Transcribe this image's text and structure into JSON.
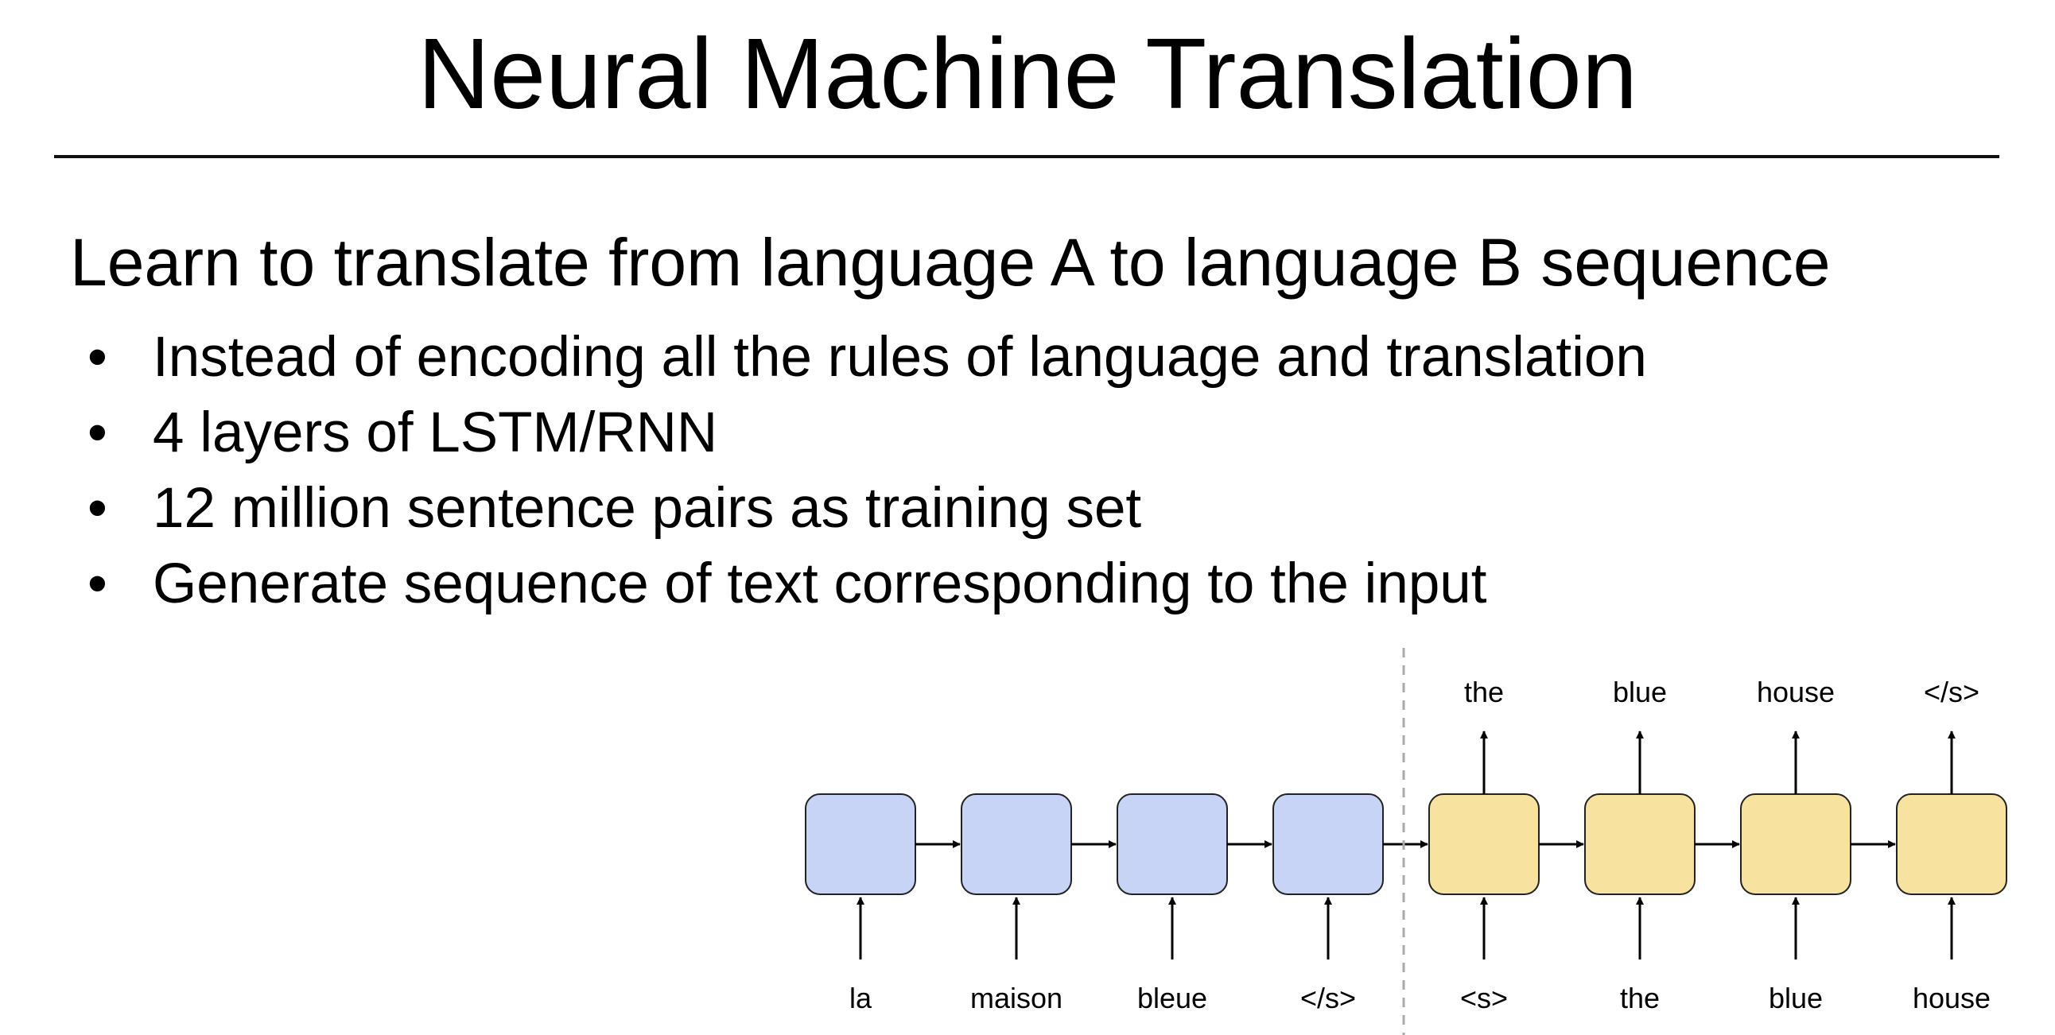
{
  "title": "Neural Machine Translation",
  "subtitle": "Learn to translate from language A to language B sequence",
  "bullets": [
    "Instead of encoding all the rules of language and translation",
    "4 layers of LSTM/RNN",
    "12 million sentence pairs as training set",
    "Generate sequence of text corresponding to the input"
  ],
  "diagram": {
    "encoder": {
      "color": "#c8d4f5",
      "inputs": [
        "la",
        "maison",
        "bleue",
        "</s>"
      ]
    },
    "decoder": {
      "color": "#f8e29f",
      "inputs": [
        "<s>",
        "the",
        "blue",
        "house"
      ],
      "outputs": [
        "the",
        "blue",
        "house",
        "</s>"
      ]
    }
  }
}
